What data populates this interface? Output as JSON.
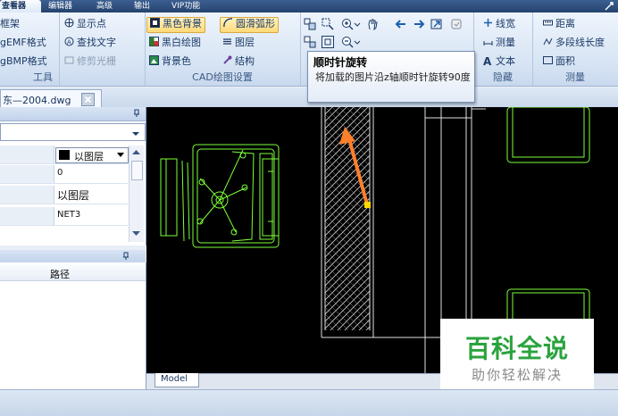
{
  "tabs": [
    "查看器",
    "编辑器",
    "高级",
    "输出",
    "VIP功能"
  ],
  "ribbon": {
    "group1": {
      "items": [
        "框架",
        "gEMF格式",
        "gBMP格式"
      ],
      "label": "工具"
    },
    "group2": {
      "items": [
        "显示点",
        "查找文字",
        "修剪光栅"
      ]
    },
    "group3": {
      "items": [
        "黑色背景",
        "黑白绘图",
        "背景色"
      ],
      "label": "CAD绘图设置"
    },
    "group4": {
      "items": [
        "圆滑弧形",
        "图层",
        "结构"
      ]
    },
    "group6": {
      "items": [
        "线宽",
        "测量",
        "文本"
      ],
      "label": "隐藏"
    },
    "group7": {
      "items": [
        "距离",
        "多段线长度",
        "面积"
      ],
      "label": "测量"
    }
  },
  "tooltip": {
    "title": "顺时针旋转",
    "body": "将加载的图片沿z轴顺时针旋转90度"
  },
  "document": {
    "tab_label": "东—2004.dwg",
    "close": "×"
  },
  "properties": {
    "layer_dropdown": "以图层",
    "rows": [
      {
        "value": "0"
      },
      {
        "value": "以图层"
      },
      {
        "value": "NET3"
      }
    ]
  },
  "file_panel": {
    "column_path": "路径"
  },
  "canvas": {
    "model_tab": "Model"
  },
  "watermark": {
    "brand": "百科全说",
    "slogan": "助你轻松解决"
  },
  "colors": {
    "accent": "#ff7f2a",
    "cad_lines": "#7cff3a",
    "cad_bg": "#000000",
    "brand_green": "#2aa33e"
  }
}
